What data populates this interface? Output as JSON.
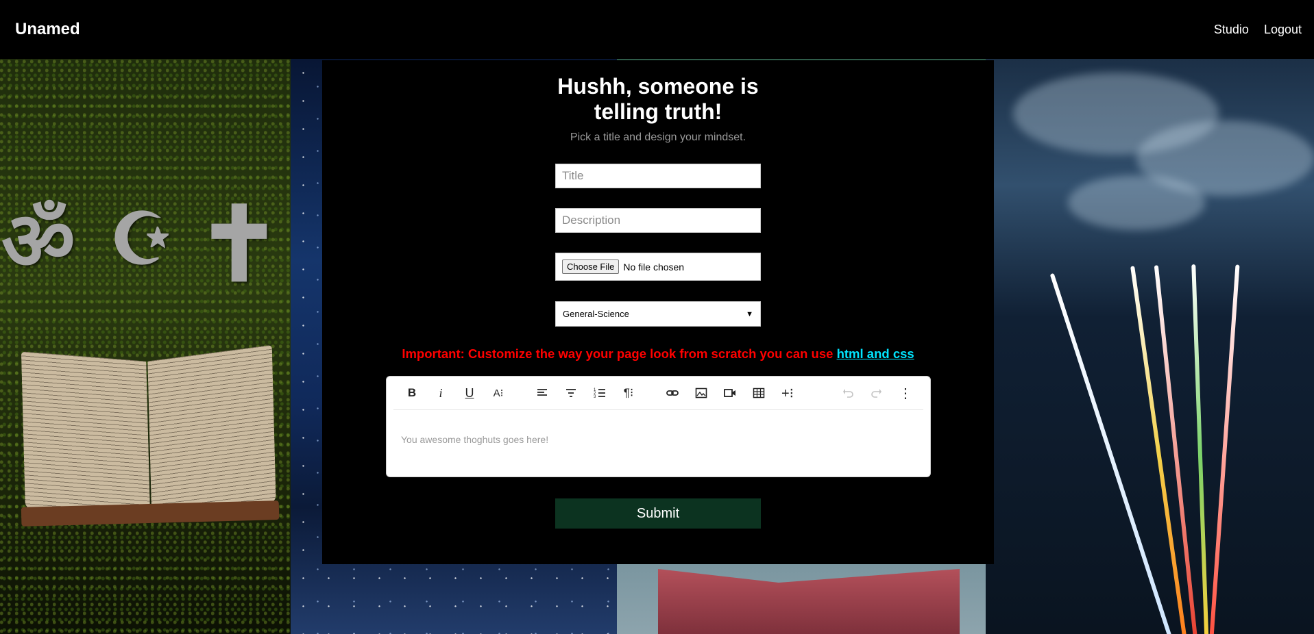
{
  "navbar": {
    "brand": "Unamed",
    "links": [
      {
        "label": "Studio"
      },
      {
        "label": "Logout"
      }
    ]
  },
  "form": {
    "heading_line1": "Hushh, someone is",
    "heading_line2": "telling truth!",
    "subtitle": "Pick a title and design your mindset.",
    "title_placeholder": "Title",
    "title_value": "",
    "description_placeholder": "Description",
    "description_value": "",
    "file_button_label": "Choose File",
    "file_status": "No file chosen",
    "category_selected": "General-Science",
    "notice_text": "Important: Customize the way your page look from scratch you can use ",
    "notice_link": "html and css",
    "editor_placeholder": "You awesome thoghuts goes here!",
    "submit_label": "Submit"
  },
  "colors": {
    "notice": "#ff0000",
    "link": "#00e5ff",
    "submit_bg": "#0c3320"
  },
  "editor_toolbar": [
    "bold-icon",
    "italic-icon",
    "underline-icon",
    "font-size-icon",
    "align-left-icon",
    "align-center-icon",
    "ordered-list-icon",
    "paragraph-icon",
    "link-icon",
    "image-icon",
    "video-icon",
    "table-icon",
    "insert-more-icon",
    "undo-icon",
    "redo-icon",
    "more-options-icon"
  ]
}
